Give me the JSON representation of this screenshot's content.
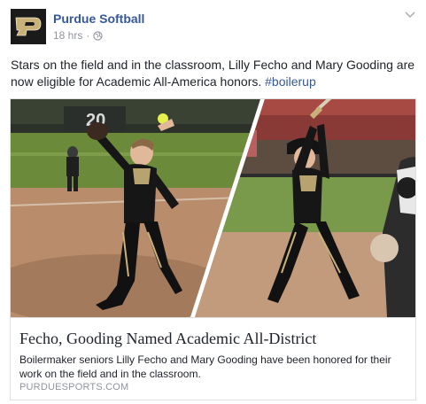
{
  "post": {
    "page_name": "Purdue Softball",
    "time": "18 hrs",
    "separator": "·",
    "text_main": "Stars on the field and in the classroom, Lilly Fecho and Mary Gooding are now eligible for Academic All-America honors.",
    "hashtag": "#boilerup"
  },
  "card": {
    "title": "Fecho, Gooding Named Academic All-District",
    "description": "Boilermaker seniors Lilly Fecho and Mary Gooding have been honored for their work on the field and in the classroom.",
    "domain": "PURDUESPORTS.COM",
    "scoreboard_number": "20"
  },
  "icons": {
    "avatar": "purdue-p-logo",
    "audience": "globe-icon",
    "options": "chevron-down-icon"
  },
  "colors": {
    "link": "#365899",
    "meta": "#90949c",
    "text": "#1d2129",
    "border": "#dddfe2",
    "purdue_gold": "#c9b27a"
  }
}
